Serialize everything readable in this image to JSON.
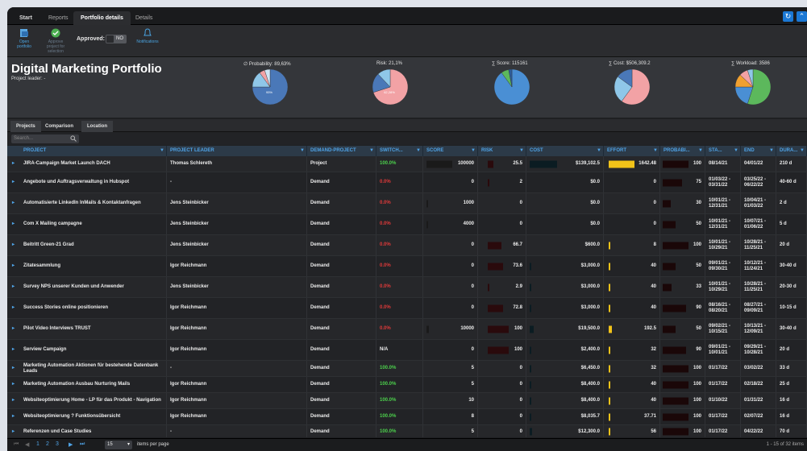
{
  "tabs": [
    "Start",
    "Reports",
    "Portfolio details",
    "Details"
  ],
  "ribbon": {
    "open_portfolio": "Open portfolio",
    "approve_project": "Approve project for selection",
    "approved_label": "Approved:",
    "approved_value": "NO",
    "notifications": "Notifications"
  },
  "header": {
    "title": "Digital Marketing Portfolio",
    "project_leader": "Project leader: -",
    "pies": [
      {
        "label": "∅ Probability: 89,63%",
        "slices": [
          {
            "value": 75,
            "color": "#4a78b8"
          },
          {
            "value": 15,
            "color": "#8fc7e8"
          },
          {
            "value": 5,
            "color": "#f2a2a5"
          },
          {
            "value": 5,
            "color": "#cfe6f5"
          }
        ],
        "inner": "95%"
      },
      {
        "label": "Risk: 21,1%",
        "slices": [
          {
            "value": 70,
            "color": "#f2a2a5"
          },
          {
            "value": 18,
            "color": "#4a78b8"
          },
          {
            "value": 12,
            "color": "#8fc7e8"
          }
        ],
        "inner": "62,28%"
      },
      {
        "label": "∑ Score: 115161",
        "slices": [
          {
            "value": 90,
            "color": "#4a8fd4"
          },
          {
            "value": 7,
            "color": "#5cb85c"
          },
          {
            "value": 3,
            "color": "#2d5d9a"
          }
        ],
        "inner": ""
      },
      {
        "label": "∑ Cost: $506,309.2",
        "slices": [
          {
            "value": 60,
            "color": "#f2a2a5"
          },
          {
            "value": 25,
            "color": "#8fc7e8"
          },
          {
            "value": 15,
            "color": "#4a78b8"
          }
        ],
        "inner": ""
      },
      {
        "label": "∑ Workload: 3586",
        "slices": [
          {
            "value": 55,
            "color": "#5cb85c"
          },
          {
            "value": 20,
            "color": "#4a8fd4"
          },
          {
            "value": 12,
            "color": "#f0a030"
          },
          {
            "value": 8,
            "color": "#f2a2a5"
          },
          {
            "value": 5,
            "color": "#8fc7e8"
          }
        ],
        "inner": ""
      }
    ]
  },
  "subtabs": [
    "Projects",
    "Comparison",
    "Location"
  ],
  "search_placeholder": "Search...",
  "columns": [
    "PROJECT",
    "PROJECT LEADER",
    "DEMAND-PROJECT",
    "SWITCH...",
    "SCORE",
    "RISK",
    "COST",
    "EFFORT",
    "PROBABI...",
    "STA...",
    "END",
    "DURA..."
  ],
  "rows": [
    {
      "project": "JIRA-Campaign Market Launch DACH",
      "leader": "Thomas Schlereth",
      "type": "Project",
      "switch": "100.0%",
      "switch_color": "green",
      "score": "100000",
      "score_level": 1.0,
      "risk": "25.5",
      "risk_level": 0.25,
      "cost": "$139,102.5",
      "cost_level": 1.0,
      "effort": "1642.48",
      "effort_level": 1.0,
      "prob": "100",
      "prob_level": 1.0,
      "start": "08/14/21",
      "end": "04/01/22",
      "duration": "210 d"
    },
    {
      "project": "Angebote und Auftragsverwaltung in Hubspot",
      "leader": "-",
      "type": "Demand",
      "switch": "0.0%",
      "switch_color": "red",
      "score": "0",
      "score_level": 0,
      "risk": "2",
      "risk_level": 0.03,
      "cost": "$0.0",
      "cost_level": 0,
      "effort": "0",
      "effort_level": 0,
      "prob": "75",
      "prob_level": 0.75,
      "start": "01/03/22 - 03/31/22",
      "end": "03/25/22 - 06/22/22",
      "duration": "40-60 d"
    },
    {
      "project": "Automatisierte LinkedIn InMails & Kontaktanfragen",
      "leader": "Jens Steinbicker",
      "type": "Demand",
      "switch": "0.0%",
      "switch_color": "red",
      "score": "1000",
      "score_level": 0.01,
      "risk": "0",
      "risk_level": 0,
      "cost": "$0.0",
      "cost_level": 0,
      "effort": "0",
      "effort_level": 0,
      "prob": "30",
      "prob_level": 0.3,
      "start": "10/01/21 - 12/31/21",
      "end": "10/04/21 - 01/03/22",
      "duration": "2 d"
    },
    {
      "project": "Com X Mailing campagne",
      "leader": "Jens Steinbicker",
      "type": "Demand",
      "switch": "0.0%",
      "switch_color": "red",
      "score": "4000",
      "score_level": 0.04,
      "risk": "0",
      "risk_level": 0,
      "cost": "$0.0",
      "cost_level": 0,
      "effort": "0",
      "effort_level": 0,
      "prob": "50",
      "prob_level": 0.5,
      "start": "10/01/21 - 12/31/21",
      "end": "10/07/21 - 01/06/22",
      "duration": "5 d"
    },
    {
      "project": "Beitritt Green-21 Grad",
      "leader": "Jens Steinbicker",
      "type": "Demand",
      "switch": "0.0%",
      "switch_color": "red",
      "score": "0",
      "score_level": 0,
      "risk": "66.7",
      "risk_level": 0.67,
      "cost": "$600.0",
      "cost_level": 0,
      "effort": "8",
      "effort_level": 0.005,
      "prob": "100",
      "prob_level": 1.0,
      "start": "10/01/21 - 10/29/21",
      "end": "10/28/21 - 11/25/21",
      "duration": "20 d"
    },
    {
      "project": "Zitatesammlung",
      "leader": "Igor Reichmann",
      "type": "Demand",
      "switch": "0.0%",
      "switch_color": "red",
      "score": "0",
      "score_level": 0,
      "risk": "73.6",
      "risk_level": 0.74,
      "cost": "$3,000.0",
      "cost_level": 0.02,
      "effort": "40",
      "effort_level": 0.024,
      "prob": "50",
      "prob_level": 0.5,
      "start": "09/01/21 - 09/30/21",
      "end": "10/12/21 - 11/24/21",
      "duration": "30-40 d"
    },
    {
      "project": "Survey NPS unserer Kunden und Anwender",
      "leader": "Jens Steinbicker",
      "type": "Demand",
      "switch": "0.0%",
      "switch_color": "red",
      "score": "0",
      "score_level": 0,
      "risk": "2.9",
      "risk_level": 0.03,
      "cost": "$3,000.0",
      "cost_level": 0.02,
      "effort": "40",
      "effort_level": 0.024,
      "prob": "33",
      "prob_level": 0.33,
      "start": "10/01/21 - 10/29/21",
      "end": "10/28/21 - 11/25/21",
      "duration": "20-30 d"
    },
    {
      "project": "Success Stories online positionieren",
      "leader": "Igor Reichmann",
      "type": "Demand",
      "switch": "0.0%",
      "switch_color": "red",
      "score": "0",
      "score_level": 0,
      "risk": "72.8",
      "risk_level": 0.73,
      "cost": "$3,000.0",
      "cost_level": 0.02,
      "effort": "40",
      "effort_level": 0.024,
      "prob": "90",
      "prob_level": 0.9,
      "start": "08/16/21 - 08/20/21",
      "end": "08/27/21 - 09/09/21",
      "duration": "10-15 d"
    },
    {
      "project": "Pilot Video Interviews TRUST",
      "leader": "Igor Reichmann",
      "type": "Demand",
      "switch": "0.0%",
      "switch_color": "red",
      "score": "10000",
      "score_level": 0.1,
      "risk": "100",
      "risk_level": 1.0,
      "cost": "$19,500.0",
      "cost_level": 0.14,
      "effort": "192.5",
      "effort_level": 0.12,
      "prob": "50",
      "prob_level": 0.5,
      "start": "09/02/21 - 10/15/21",
      "end": "10/13/21 - 12/09/21",
      "duration": "30-40 d"
    },
    {
      "project": "Serview Campaign",
      "leader": "Igor Reichmann",
      "type": "Demand",
      "switch": "N/A",
      "switch_color": "white",
      "score": "0",
      "score_level": 0,
      "risk": "100",
      "risk_level": 1.0,
      "cost": "$2,400.0",
      "cost_level": 0.017,
      "effort": "32",
      "effort_level": 0.02,
      "prob": "90",
      "prob_level": 0.9,
      "start": "09/01/21 - 10/01/21",
      "end": "09/29/21 - 10/28/21",
      "duration": "20 d"
    },
    {
      "project": "Marketing Automation Aktionen für bestehende Datenbank Leads",
      "leader": "-",
      "type": "Demand",
      "switch": "100.0%",
      "switch_color": "green",
      "score": "5",
      "score_level": 0,
      "risk": "0",
      "risk_level": 0,
      "cost": "$6,450.0",
      "cost_level": 0.046,
      "effort": "32",
      "effort_level": 0.02,
      "prob": "100",
      "prob_level": 1.0,
      "start": "01/17/22",
      "end": "03/02/22",
      "duration": "33 d"
    },
    {
      "project": "Marketing Automation Ausbau Nurturing Mails",
      "leader": "Igor Reichmann",
      "type": "Demand",
      "switch": "100.0%",
      "switch_color": "green",
      "score": "5",
      "score_level": 0,
      "risk": "0",
      "risk_level": 0,
      "cost": "$8,400.0",
      "cost_level": 0.06,
      "effort": "40",
      "effort_level": 0.024,
      "prob": "100",
      "prob_level": 1.0,
      "start": "01/17/22",
      "end": "02/18/22",
      "duration": "25 d"
    },
    {
      "project": "Websiteoptimierung Home - LP für das Produkt - Navigation",
      "leader": "Igor Reichmann",
      "type": "Demand",
      "switch": "100.0%",
      "switch_color": "green",
      "score": "10",
      "score_level": 0,
      "risk": "0",
      "risk_level": 0,
      "cost": "$8,400.0",
      "cost_level": 0.06,
      "effort": "40",
      "effort_level": 0.024,
      "prob": "100",
      "prob_level": 1.0,
      "start": "01/10/22",
      "end": "01/31/22",
      "duration": "16 d"
    },
    {
      "project": "Websiteoptimierung ? Funktionsübersicht",
      "leader": "Igor Reichmann",
      "type": "Demand",
      "switch": "100.0%",
      "switch_color": "green",
      "score": "8",
      "score_level": 0,
      "risk": "0",
      "risk_level": 0,
      "cost": "$8,035.7",
      "cost_level": 0.058,
      "effort": "37.71",
      "effort_level": 0.023,
      "prob": "100",
      "prob_level": 1.0,
      "start": "01/17/22",
      "end": "02/07/22",
      "duration": "16 d"
    },
    {
      "project": "Referenzen und Case Studies",
      "leader": "-",
      "type": "Demand",
      "switch": "100.0%",
      "switch_color": "green",
      "score": "5",
      "score_level": 0,
      "risk": "0",
      "risk_level": 0,
      "cost": "$12,300.0",
      "cost_level": 0.088,
      "effort": "56",
      "effort_level": 0.034,
      "prob": "100",
      "prob_level": 1.0,
      "start": "01/17/22",
      "end": "04/22/22",
      "duration": "70 d"
    }
  ],
  "footer": {
    "pages": [
      "1",
      "2",
      "3"
    ],
    "per_page": "15",
    "per_page_label": "items per page",
    "range": "1 - 15 of 32 items"
  },
  "colors": {
    "accent": "#4fa3e6",
    "score_bar": "#1a1a1a",
    "risk_bar": "#2a0a0c",
    "cost_bar": "#0b1c22",
    "effort_bar": "#f2c319",
    "prob_bar": "#1a0708",
    "green": "#4cd04c",
    "red": "#e23a3a"
  }
}
